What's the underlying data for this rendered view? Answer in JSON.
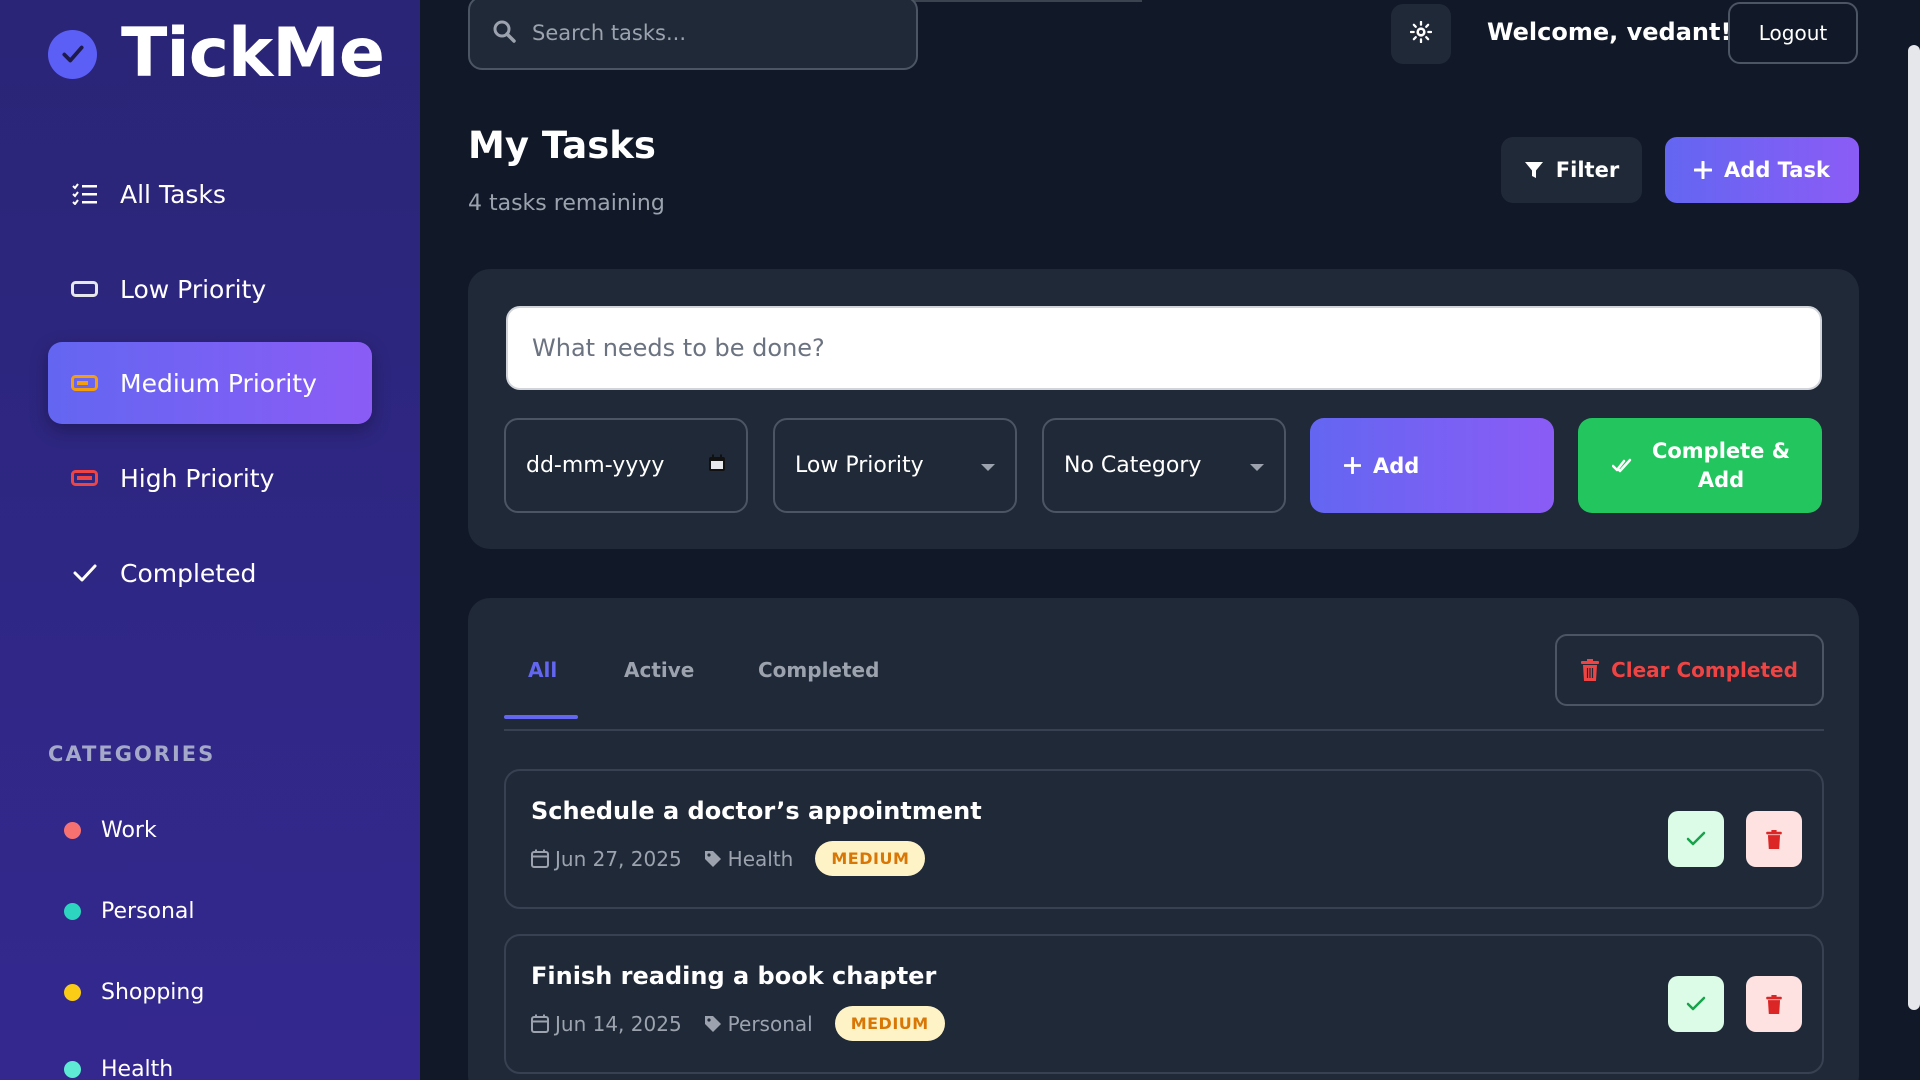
{
  "app": {
    "name": "TickMe",
    "logo_icon": "check-circle-icon"
  },
  "sidebar": {
    "items": [
      {
        "label": "All Tasks",
        "icon": "list-check-icon",
        "active": false
      },
      {
        "label": "Low Priority",
        "icon": "battery-empty-icon",
        "color": "#e5e7eb",
        "active": false
      },
      {
        "label": "Medium Priority",
        "icon": "battery-half-icon",
        "color": "#f59e0b",
        "active": true
      },
      {
        "label": "High Priority",
        "icon": "battery-full-icon",
        "color": "#ef4444",
        "active": false
      },
      {
        "label": "Completed",
        "icon": "check-icon",
        "active": false
      }
    ],
    "categories_title": "CATEGORIES",
    "categories": [
      {
        "label": "Work",
        "color": "#f87171"
      },
      {
        "label": "Personal",
        "color": "#2dd4bf"
      },
      {
        "label": "Shopping",
        "color": "#facc15"
      },
      {
        "label": "Health",
        "color": "#5eead4"
      }
    ]
  },
  "header": {
    "search_placeholder": "Search tasks...",
    "welcome": "Welcome, vedant!",
    "logout_label": "Logout",
    "theme_icon": "sun-icon"
  },
  "page": {
    "title": "My Tasks",
    "subtitle": "4 tasks remaining",
    "filter_label": "Filter",
    "add_task_label": "Add Task"
  },
  "composer": {
    "placeholder": "What needs to be done?",
    "date_placeholder": "dd-mm-yyyy",
    "priority_value": "Low Priority",
    "category_value": "No Category",
    "add_label": "Add",
    "complete_add_label": "Complete & Add"
  },
  "list": {
    "tabs": [
      {
        "label": "All",
        "active": true
      },
      {
        "label": "Active",
        "active": false
      },
      {
        "label": "Completed",
        "active": false
      }
    ],
    "clear_label": "Clear Completed",
    "tasks": [
      {
        "title": "Schedule a doctor’s appointment",
        "date": "Jun 27, 2025",
        "category": "Health",
        "priority": "MEDIUM"
      },
      {
        "title": "Finish reading a book chapter",
        "date": "Jun 14, 2025",
        "category": "Personal",
        "priority": "MEDIUM"
      }
    ]
  },
  "colors": {
    "accent": "#6366f1",
    "accent_2": "#8b5cf6",
    "success": "#22c55e",
    "danger": "#ef4444",
    "sidebar_bg": "#2f2785",
    "main_bg": "#111827",
    "card_bg": "#1f2937"
  }
}
